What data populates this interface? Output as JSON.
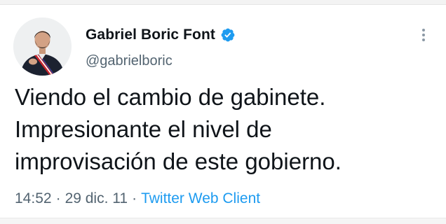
{
  "tweet": {
    "author": {
      "display_name": "Gabriel Boric Font",
      "handle": "@gabrielboric",
      "verified": true
    },
    "text_lines": [
      "Viendo el cambio de gabinete.",
      "Impresionante el nivel de",
      "improvisación de este gobierno."
    ],
    "meta": {
      "time": "14:52",
      "separator": "·",
      "date": "29 dic. 11",
      "client": "Twitter Web Client"
    }
  },
  "icons": {
    "verified": "verified-badge-icon",
    "more": "more-options-icon"
  },
  "colors": {
    "link": "#1d9bf0",
    "verified": "#1d9bf0",
    "secondary_text": "#536471",
    "primary_text": "#0f1419"
  }
}
